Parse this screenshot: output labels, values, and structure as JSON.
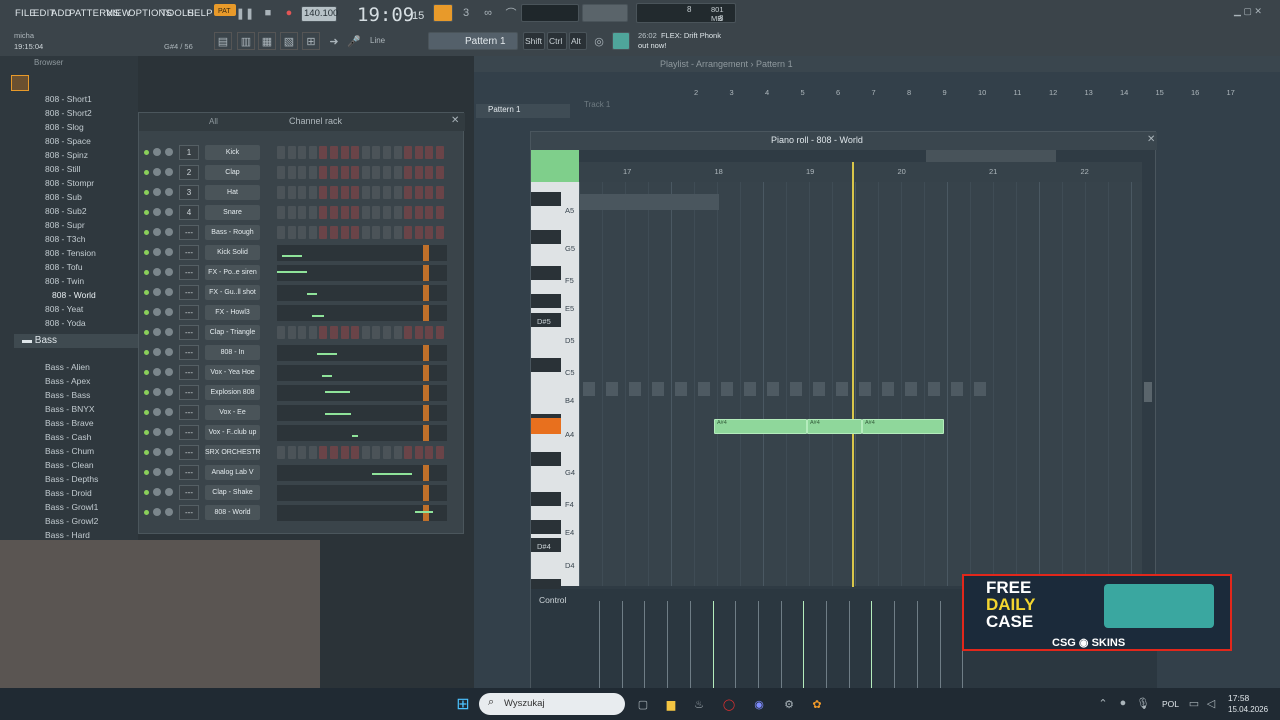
{
  "menu": [
    "FILE",
    "EDIT",
    "ADD",
    "PATTERNS",
    "VIEW",
    "OPTIONS",
    "TOOLS",
    "HELP"
  ],
  "transport": {
    "pat_label": "PAT",
    "tempo": "140.100",
    "time": "19:09",
    "time_ms": "15",
    "cpu": "8",
    "ram": "801 MB",
    "polyphony": "8"
  },
  "user": {
    "name": "micha",
    "time": "19:15:04",
    "note": "G#4 / 56"
  },
  "toolbar": {
    "snap": "Line",
    "pattern": "Pattern 1",
    "shift": "Shift",
    "ctrl": "Ctrl",
    "alt": "Alt"
  },
  "news": {
    "time": "26:02",
    "text": "FLEX: Drift Phonk",
    "text2": "out now!"
  },
  "browser": {
    "title": "Browser",
    "items": [
      "808 - Short1",
      "808 - Short2",
      "808 - Slog",
      "808 - Space",
      "808 - Spinz",
      "808 - Still",
      "808 - Stompr",
      "808 - Sub",
      "808 - Sub2",
      "808 - Supr",
      "808 - T3ch",
      "808 - Tension",
      "808 - Tofu",
      "808 - Twin",
      "808 - World",
      "808 - Yeat",
      "808 - Yoda"
    ],
    "folder": "Bass",
    "bass_items": [
      "Bass - Alien",
      "Bass - Apex",
      "Bass - Bass",
      "Bass - BNYX",
      "Bass - Brave",
      "Bass - Cash",
      "Bass - Chum",
      "Bass - Clean",
      "Bass - Depths",
      "Bass - Droid",
      "Bass - Growl1",
      "Bass - Growl2",
      "Bass - Hard"
    ]
  },
  "channel_rack": {
    "title": "Channel rack",
    "filter": "All",
    "channels": [
      {
        "num": "1",
        "name": "Kick"
      },
      {
        "num": "2",
        "name": "Clap"
      },
      {
        "num": "3",
        "name": "Hat"
      },
      {
        "num": "4",
        "name": "Snare"
      },
      {
        "num": "---",
        "name": "Bass - Rough"
      },
      {
        "num": "---",
        "name": "Kick Solid"
      },
      {
        "num": "---",
        "name": "FX - Po..e siren"
      },
      {
        "num": "---",
        "name": "FX - Gu..ll shot"
      },
      {
        "num": "---",
        "name": "FX - Howl3"
      },
      {
        "num": "---",
        "name": "Clap - Triangle"
      },
      {
        "num": "---",
        "name": "808 - In"
      },
      {
        "num": "---",
        "name": "Vox - Yea Hoe"
      },
      {
        "num": "---",
        "name": "Explosion 808"
      },
      {
        "num": "---",
        "name": "Vox - Ee"
      },
      {
        "num": "---",
        "name": "Vox - F..club up"
      },
      {
        "num": "---",
        "name": "SRX ORCHESTRA"
      },
      {
        "num": "---",
        "name": "Analog Lab V"
      },
      {
        "num": "---",
        "name": "Clap - Shake"
      },
      {
        "num": "---",
        "name": "808 - World"
      }
    ]
  },
  "playlist": {
    "title": "Playlist - Arrangement",
    "pattern": "Pattern 1",
    "track": "Track 1",
    "bars": [
      "2",
      "3",
      "4",
      "5",
      "6",
      "7",
      "8",
      "9",
      "10",
      "11",
      "12",
      "13",
      "14",
      "15",
      "16",
      "17"
    ]
  },
  "piano_roll": {
    "title": "Piano roll - 808 - World",
    "bars": [
      "17",
      "18",
      "19",
      "20",
      "21",
      "22"
    ],
    "keys": [
      "A5",
      "G5",
      "F5",
      "E5",
      "D#5",
      "D5",
      "C5",
      "B4",
      "A4",
      "G4",
      "F4",
      "E4",
      "D#4",
      "D4"
    ],
    "notes": [
      "A#4",
      "A#4",
      "A#4"
    ],
    "control": "Control"
  },
  "ad": {
    "line1": "FREE",
    "line2": "DAILY",
    "line3": "CASE",
    "brand": "CSG",
    "brand2": "SKINS"
  },
  "taskbar": {
    "search": "Wyszukaj",
    "lang": "POL",
    "time": "17:58",
    "date": "15.04.2026"
  }
}
